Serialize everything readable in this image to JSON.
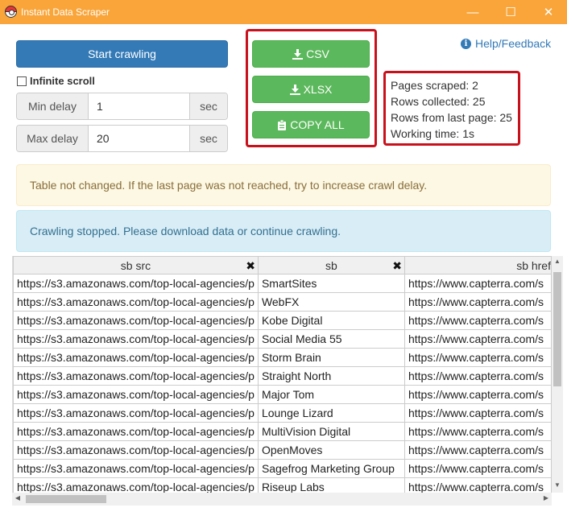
{
  "window": {
    "title": "Instant Data Scraper",
    "minimize_glyph": "—",
    "maximize_glyph": "☐",
    "close_glyph": "✕"
  },
  "controls": {
    "start_crawling_label": "Start crawling",
    "infinite_scroll_label": "Infinite scroll",
    "infinite_scroll_checked": false,
    "min_delay": {
      "label": "Min delay",
      "value": "1",
      "unit": "sec"
    },
    "max_delay": {
      "label": "Max delay",
      "value": "20",
      "unit": "sec"
    }
  },
  "export": {
    "csv_label": "CSV",
    "xlsx_label": "XLSX",
    "copy_all_label": "COPY ALL"
  },
  "help": {
    "label": "Help/Feedback"
  },
  "stats": {
    "pages_scraped": "Pages scraped: 2",
    "rows_collected": "Rows collected: 25",
    "rows_from_last_page": "Rows from last page: 25",
    "working_time": "Working time: 1s"
  },
  "alerts": {
    "warning": "Table not changed. If the last page was not reached, try to increase crawl delay.",
    "info": "Crawling stopped. Please download data or continue crawling."
  },
  "table": {
    "columns": [
      "sb src",
      "sb",
      "sb href"
    ],
    "rows": [
      [
        "https://s3.amazonaws.com/top-local-agencies/p",
        "SmartSites",
        "https://www.capterra.com/s"
      ],
      [
        "https://s3.amazonaws.com/top-local-agencies/p",
        "WebFX",
        "https://www.capterra.com/s"
      ],
      [
        "https://s3.amazonaws.com/top-local-agencies/p",
        "Kobe Digital",
        "https://www.capterra.com/s"
      ],
      [
        "https://s3.amazonaws.com/top-local-agencies/p",
        "Social Media 55",
        "https://www.capterra.com/s"
      ],
      [
        "https://s3.amazonaws.com/top-local-agencies/p",
        "Storm Brain",
        "https://www.capterra.com/s"
      ],
      [
        "https://s3.amazonaws.com/top-local-agencies/p",
        "Straight North",
        "https://www.capterra.com/s"
      ],
      [
        "https://s3.amazonaws.com/top-local-agencies/p",
        "Major Tom",
        "https://www.capterra.com/s"
      ],
      [
        "https://s3.amazonaws.com/top-local-agencies/p",
        "Lounge Lizard",
        "https://www.capterra.com/s"
      ],
      [
        "https://s3.amazonaws.com/top-local-agencies/p",
        "MultiVision Digital",
        "https://www.capterra.com/s"
      ],
      [
        "https://s3.amazonaws.com/top-local-agencies/p",
        "OpenMoves",
        "https://www.capterra.com/s"
      ],
      [
        "https://s3.amazonaws.com/top-local-agencies/p",
        "Sagefrog Marketing Group",
        "https://www.capterra.com/s"
      ],
      [
        "https://s3.amazonaws.com/top-local-agencies/p",
        "Riseup Labs",
        "https://www.capterra.com/s"
      ]
    ]
  },
  "colors": {
    "titlebar": "#f9a53a",
    "primary": "#337ab7",
    "success": "#5cb85c",
    "highlight_red": "#c9111c"
  }
}
